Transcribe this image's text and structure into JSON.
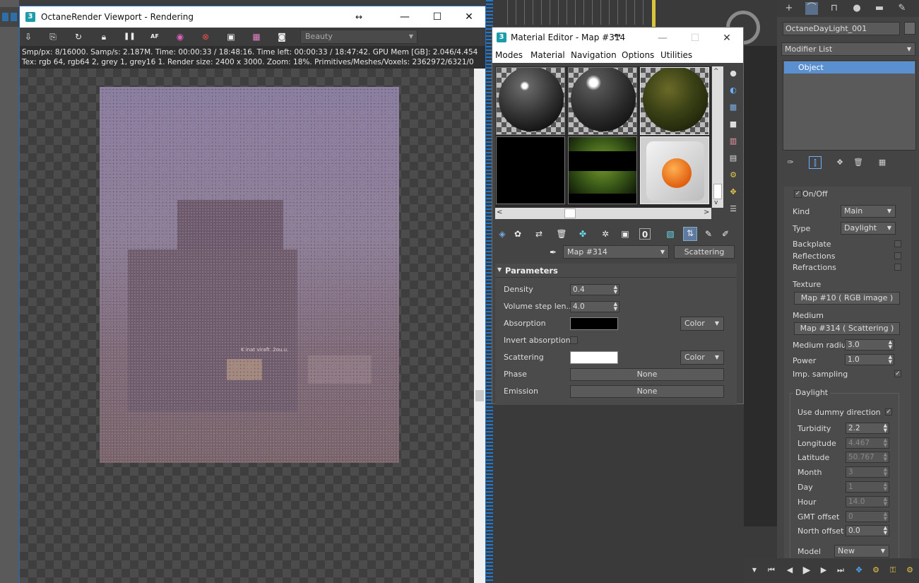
{
  "octane": {
    "title": "OctaneRender Viewport - Rendering",
    "app_icon": "3",
    "display_mode": "Beauty",
    "stats_line1": "Smp/px: 8/16000.   Samp/s: 2.187M.   Time: 00:00:33 / 18:48:16.   Time left: 00:00:33 / 18:47:42.   GPU Mem [GB]: 2.046/4.454",
    "stats_line2": "Tex: rgb 64, rgb64 2, grey 1, grey16 1.   Render size: 2400 x 3000.   Zoom: 18%.   Primitives/Meshes/Voxels: 2362972/6321/0",
    "toolbar_icons": [
      "save-render-icon",
      "copy-icon",
      "restart-icon",
      "lock-icon",
      "pause-icon",
      "autofocus-icon",
      "color-picker-icon",
      "region-icon",
      "viewport-icon",
      "film-icon",
      "camera-icon"
    ],
    "pause_glyph": "❚❚",
    "af_glyph": "AF",
    "render_caption": "K  inat viraft  .2ou.u."
  },
  "material_editor": {
    "title": "Material Editor - Map #314",
    "app_icon": "3",
    "menus": [
      "Modes",
      "Material",
      "Navigation",
      "Options",
      "Utilities"
    ],
    "map_name": "Map #314",
    "map_type": "Scattering",
    "rollout_title": "Parameters",
    "params": {
      "density_label": "Density",
      "density_value": "0.4",
      "step_label": "Volume step len...",
      "step_value": "4.0",
      "absorption_label": "Absorption",
      "absorption_color": "#000000",
      "absorption_mode": "Color",
      "invert_label": "Invert absorption",
      "scattering_label": "Scattering",
      "scattering_color": "#ffffff",
      "scattering_mode": "Color",
      "phase_label": "Phase",
      "phase_value": "None",
      "emission_label": "Emission",
      "emission_value": "None"
    },
    "zero_glyph": "0"
  },
  "command_panel": {
    "object_name": "OctaneDayLight_001",
    "modifier_list": "Modifier List",
    "stack_item": "Object",
    "onoff_label": "On/Off",
    "kind_label": "Kind",
    "kind_value": "Main",
    "type_label": "Type",
    "type_value": "Daylight",
    "backplate_label": "Backplate",
    "reflections_label": "Reflections",
    "refractions_label": "Refractions",
    "texture_label": "Texture",
    "texture_value": "Map #10  ( RGB image )",
    "medium_label": "Medium",
    "medium_value": "Map #314  ( Scattering )",
    "medium_radius_label": "Medium radius",
    "medium_radius_value": "3.0",
    "power_label": "Power",
    "power_value": "1.0",
    "imp_sampling_label": "Imp. sampling",
    "daylight_group": "Daylight",
    "dummy_label": "Use dummy direction",
    "turbidity_label": "Turbidity",
    "turbidity_value": "2.2",
    "longitude_label": "Longitude",
    "longitude_value": "4.467",
    "latitude_label": "Latitude",
    "latitude_value": "50.767",
    "month_label": "Month",
    "month_value": "3",
    "day_label": "Day",
    "day_value": "1",
    "hour_label": "Hour",
    "hour_value": "14.0",
    "gmt_label": "GMT offset",
    "gmt_value": "0",
    "north_label": "North offset",
    "north_value": "0.0",
    "model_label": "Model",
    "model_value": "New"
  },
  "glyphs": {
    "minimize": "—",
    "maximize": "☐",
    "close": "✕",
    "resize": "↔",
    "dropdown": "▼",
    "check": "✓",
    "left": "<",
    "right": ">",
    "up": "^",
    "down": "v",
    "spin": "▲▼",
    "collapse": "▼"
  }
}
